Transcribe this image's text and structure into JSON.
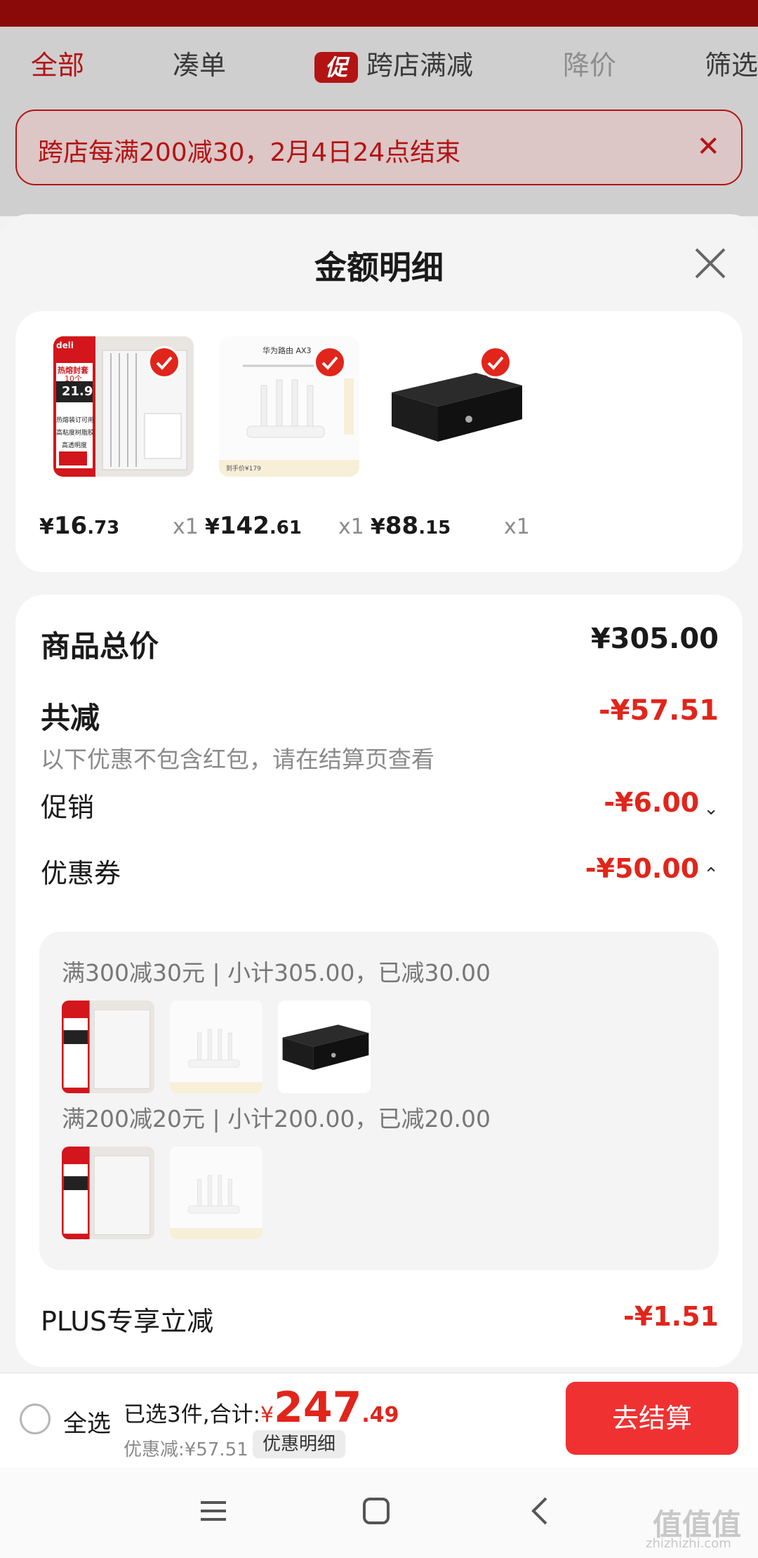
{
  "background": {
    "tabs": {
      "all": "全部",
      "bundle": "凑单",
      "promo_badge": "促",
      "cross_store": "跨店满减",
      "price_drop": "降价",
      "filter": "筛选"
    },
    "notice": {
      "text": "跨店每满200减30，2月4日24点结束",
      "close": "✕"
    }
  },
  "sheet": {
    "title": "金额明细",
    "products": [
      {
        "name": "deli-file-folder",
        "price_symbol": "¥",
        "price_int": "16",
        "price_dec": ".73",
        "qty": "x1",
        "selected": true
      },
      {
        "name": "huawei-router-ax3",
        "price_symbol": "¥",
        "price_int": "142",
        "price_dec": ".61",
        "qty": "x1",
        "selected": true
      },
      {
        "name": "black-cash-drawer",
        "price_symbol": "¥",
        "price_int": "88",
        "price_dec": ".15",
        "qty": "x1",
        "selected": true
      }
    ],
    "thumb_text": {
      "deli_logo": "deli",
      "deli_hot": "热熔封套",
      "deli_count": "10个",
      "deli_price": "21.9",
      "deli_feat1": "热熔装订可用",
      "deli_feat2": "高粘度树脂胶",
      "deli_feat3": "高透明度",
      "router_title": "华为路由 AX3",
      "router_tag": "到手价¥179"
    },
    "detail": {
      "goods_total_label": "商品总价",
      "goods_total_value": "¥305.00",
      "total_reduce_label": "共减",
      "total_reduce_value": "-¥57.51",
      "note": "以下优惠不包含红包，请在结算页查看",
      "promo_label": "促销",
      "promo_value": "-¥6.00",
      "coupon_label": "优惠券",
      "coupon_value": "-¥50.00",
      "coupon_groups": [
        {
          "text": "满300减30元 | 小计305.00，已减30.00"
        },
        {
          "text": "满200减20元 | 小计200.00，已减20.00"
        }
      ],
      "plus_label": "PLUS专享立减",
      "plus_value": "-¥1.51"
    }
  },
  "bottom_bar": {
    "select_all": "全选",
    "selected_prefix": "已选3件,合计:",
    "total_symbol": "¥",
    "total_int": "247",
    "total_dec": ".49",
    "discount": "优惠减:¥57.51",
    "detail_chip": "优惠明细",
    "checkout": "去结算"
  },
  "watermark": {
    "main": "值值值",
    "sub": "zhizhizhi.com"
  },
  "colors": {
    "accent_red": "#e1251b",
    "checkout_red": "#f03131",
    "bg_promo_red": "#b31313"
  }
}
